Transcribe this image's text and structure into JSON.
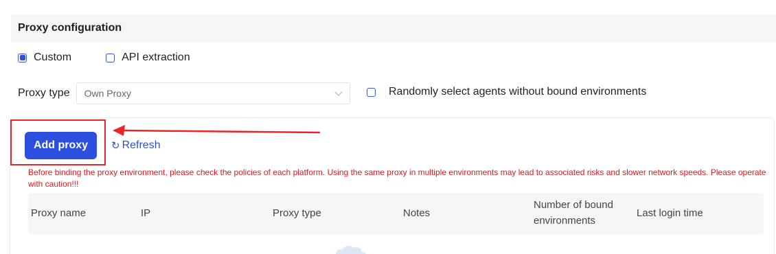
{
  "section": {
    "title": "Proxy configuration"
  },
  "mode": {
    "custom_label": "Custom",
    "custom_checked": true,
    "api_label": "API extraction",
    "api_checked": false
  },
  "proxy_type": {
    "label": "Proxy type",
    "selected": "Own Proxy",
    "random_label": "Randomly select agents without bound environments"
  },
  "actions": {
    "add_label": "Add proxy",
    "refresh_label": "Refresh"
  },
  "warning": "Before binding the proxy environment, please check the policies of each platform. Using the same proxy in multiple environments may lead to associated risks and slower network speeds. Please operate with caution!!!",
  "table": {
    "columns": [
      "Proxy name",
      "IP",
      "Proxy type",
      "Notes",
      "Number of bound environments",
      "Last login time"
    ]
  },
  "colors": {
    "accent": "#2d4fe0",
    "warning": "#e0161c",
    "annotation": "#e8252a"
  },
  "icons": {
    "refresh": "refresh-icon",
    "chevron": "chevron-down-icon"
  }
}
